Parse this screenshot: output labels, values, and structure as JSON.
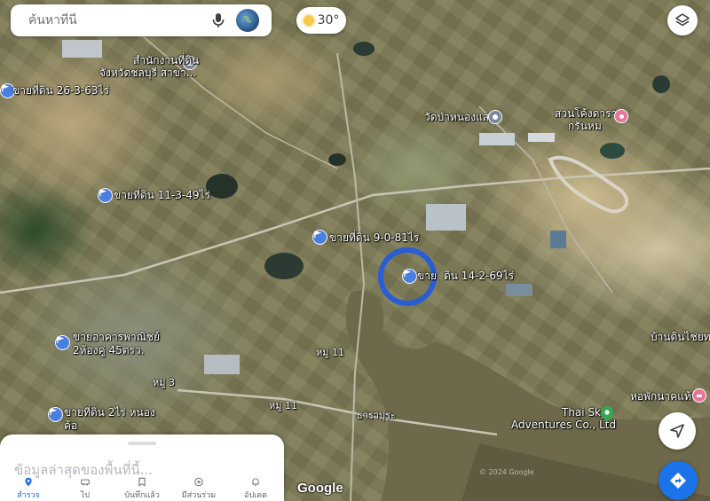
{
  "search": {
    "placeholder": "ค้นหาที่นี่"
  },
  "weather": {
    "temperature": "30°"
  },
  "map": {
    "attribution": "Google",
    "copyright": "© 2024 Google",
    "place_labels": [
      {
        "text": "สำนักงานที่ดิน",
        "kind": "poi"
      },
      {
        "text": "จังหวัดชลบุรี สาขา...",
        "kind": "poi"
      },
      {
        "text": "ขายที่ดิน 26-3-63ไร่",
        "kind": "listing"
      },
      {
        "text": "วัดป่าหนองแสง",
        "kind": "temple"
      },
      {
        "text": "สวนโค้งดารา",
        "kind": "park"
      },
      {
        "text": "กรันหม",
        "kind": "park"
      },
      {
        "text": "ขายที่ดิน 11-3-49ไร่",
        "kind": "listing"
      },
      {
        "text": "ขายที่ดิน 9-0-81ไร่",
        "kind": "listing"
      },
      {
        "text": "ขาย",
        "kind": "listing-selected"
      },
      {
        "text": "ดิน 14-2-69ไร่",
        "kind": "listing-selected"
      },
      {
        "text": "ขายอาคารพาณิชย์",
        "kind": "listing"
      },
      {
        "text": "2ห้องคู่ 45ตรว.",
        "kind": "listing"
      },
      {
        "text": "หมู่ 11",
        "kind": "road"
      },
      {
        "text": "หมู่ 3",
        "kind": "road"
      },
      {
        "text": "หมู่ 11",
        "kind": "road"
      },
      {
        "text": "ขายที่ดิน 2ไร่ หนอง",
        "kind": "listing"
      },
      {
        "text": "ค้อ",
        "kind": "listing"
      },
      {
        "text": "ธาราบุระ",
        "kind": "area"
      },
      {
        "text": "บ้านดินไชยทอ",
        "kind": "area"
      },
      {
        "text": "หอพักนาคแท้",
        "kind": "lodging"
      },
      {
        "text": "Thai Sky",
        "kind": "poi-green"
      },
      {
        "text": "Adventures Co., Ltd",
        "kind": "poi-green"
      }
    ]
  },
  "panel": {
    "title": "ข้อมูลล่าสุดของพื้นที่นี้...",
    "nav": [
      {
        "label": "สำรวจ",
        "icon": "pin-icon",
        "active": true
      },
      {
        "label": "ไป",
        "icon": "car-icon",
        "active": false
      },
      {
        "label": "บันทึกแล้ว",
        "icon": "bookmark-icon",
        "active": false
      },
      {
        "label": "มีส่วนร่วม",
        "icon": "plus-circle-icon",
        "active": false
      },
      {
        "label": "อัปเดต",
        "icon": "bell-icon",
        "active": false
      }
    ]
  },
  "colors": {
    "accent": "#1a73e8",
    "listing_pin": "#4a7fe0",
    "selection_ring": "#2a5cd4",
    "water": "#6b6748"
  }
}
